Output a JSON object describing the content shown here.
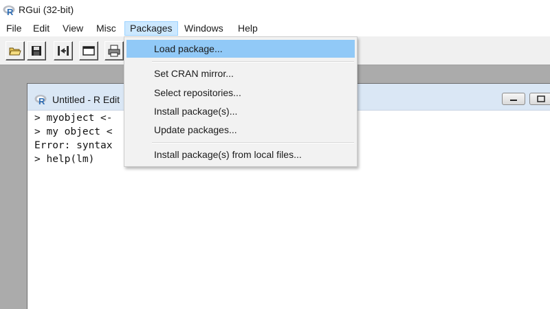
{
  "window": {
    "title": "RGui (32-bit)",
    "logo_text": "R",
    "logo_color": "#2d6db5"
  },
  "menubar": {
    "items": [
      {
        "label": "File"
      },
      {
        "label": "Edit"
      },
      {
        "label": "View"
      },
      {
        "label": "Misc"
      },
      {
        "label": "Packages",
        "active": true
      },
      {
        "label": "Windows"
      },
      {
        "label": "Help"
      }
    ]
  },
  "toolbar": {
    "buttons": [
      {
        "icon": "open-folder-icon"
      },
      {
        "icon": "save-icon"
      },
      {
        "icon": "load-workspace-icon"
      },
      {
        "icon": "console-window-icon"
      },
      {
        "icon": "print-icon"
      }
    ]
  },
  "editor": {
    "title": "Untitled - R Edit",
    "lines": [
      "> myobject <-",
      "> my object <",
      "Error: syntax",
      "> help(lm)"
    ]
  },
  "packages_menu": {
    "items": [
      {
        "label": "Load package...",
        "highlighted": true
      },
      {
        "label": "Set CRAN mirror..."
      },
      {
        "label": "Select repositories..."
      },
      {
        "label": "Install package(s)..."
      },
      {
        "label": "Update packages..."
      },
      {
        "label": "Install package(s) from local files..."
      }
    ],
    "highlight_color": "#91c9f7"
  }
}
